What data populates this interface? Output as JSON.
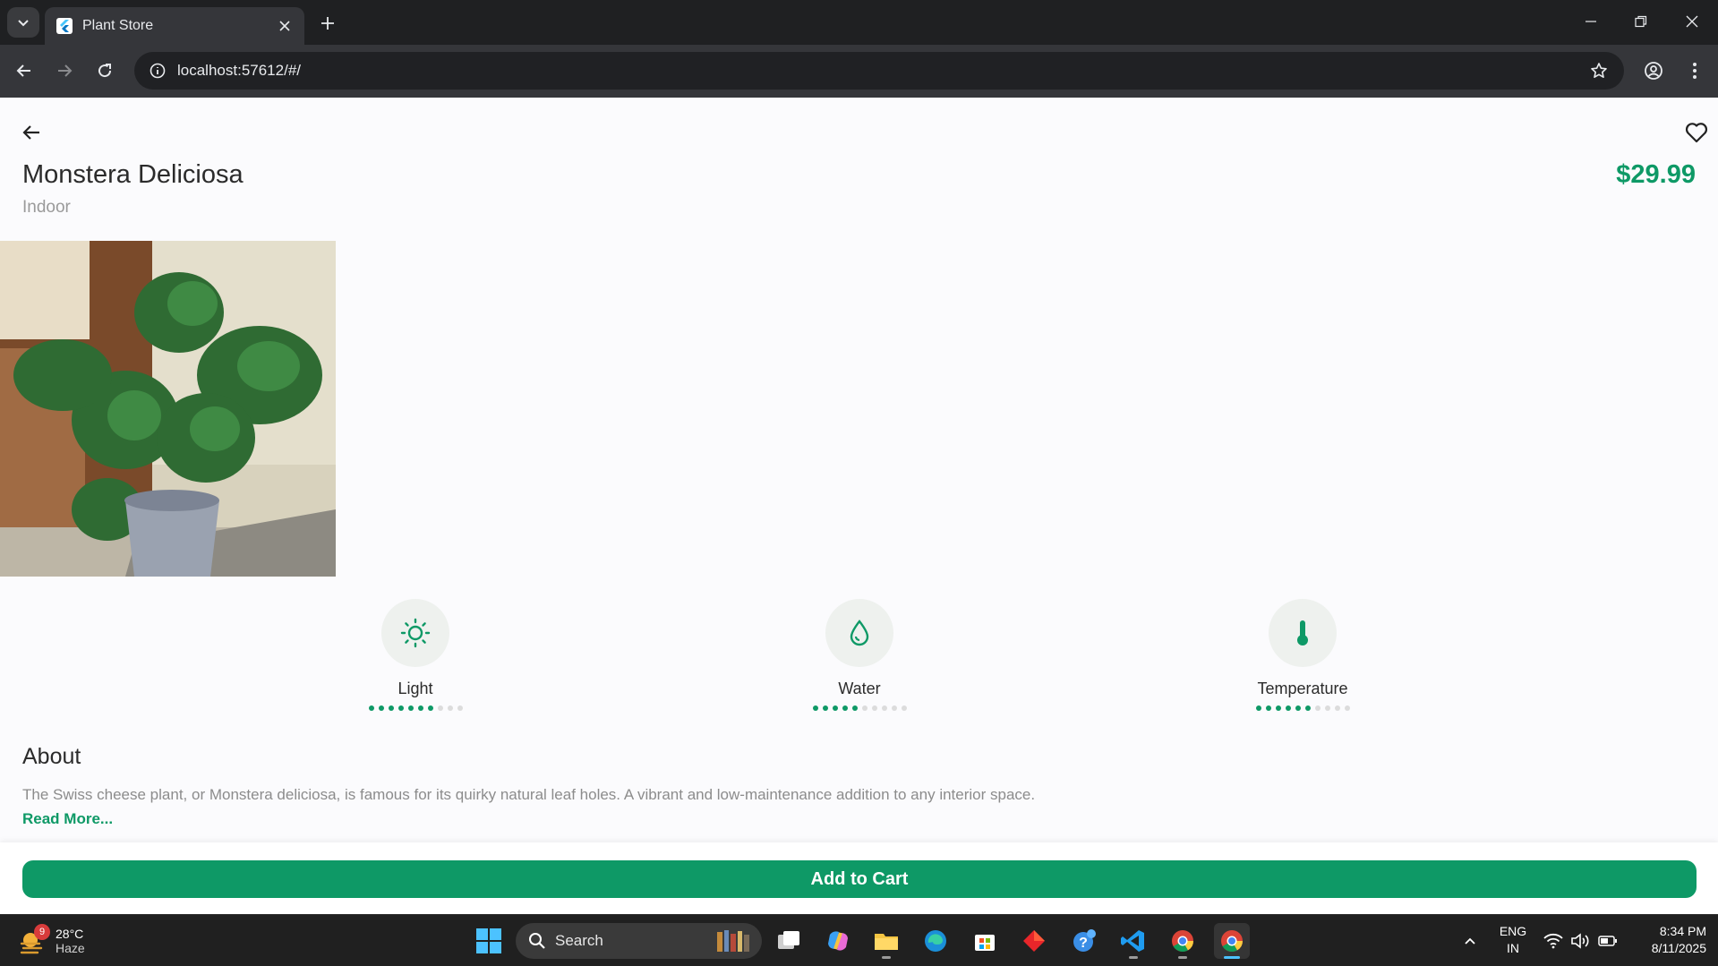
{
  "browser": {
    "tab_title": "Plant Store",
    "url": "localhost:57612/#/"
  },
  "plant": {
    "name": "Monstera Deliciosa",
    "category": "Indoor",
    "price": "$29.99",
    "image_alt": "monstera-plant-photo"
  },
  "care": [
    {
      "label": "Light",
      "icon": "sun-icon",
      "level": 7,
      "max": 10
    },
    {
      "label": "Water",
      "icon": "water-drop-icon",
      "level": 5,
      "max": 10
    },
    {
      "label": "Temperature",
      "icon": "thermometer-icon",
      "level": 6,
      "max": 10
    }
  ],
  "about": {
    "title": "About",
    "text": "The Swiss cheese plant, or Monstera deliciosa, is famous for its quirky natural leaf holes. A vibrant and low-maintenance addition to any interior space.",
    "read_more": "Read More..."
  },
  "cart": {
    "label": "Add to Cart"
  },
  "colors": {
    "accent": "#0e9966",
    "chrome_bg": "#35363a",
    "taskbar_bg": "#202020"
  },
  "taskbar": {
    "weather": {
      "badge": "9",
      "temp": "28°C",
      "condition": "Haze"
    },
    "search_label": "Search",
    "language": [
      "ENG",
      "IN"
    ],
    "time": "8:34 PM",
    "date": "8/11/2025"
  }
}
